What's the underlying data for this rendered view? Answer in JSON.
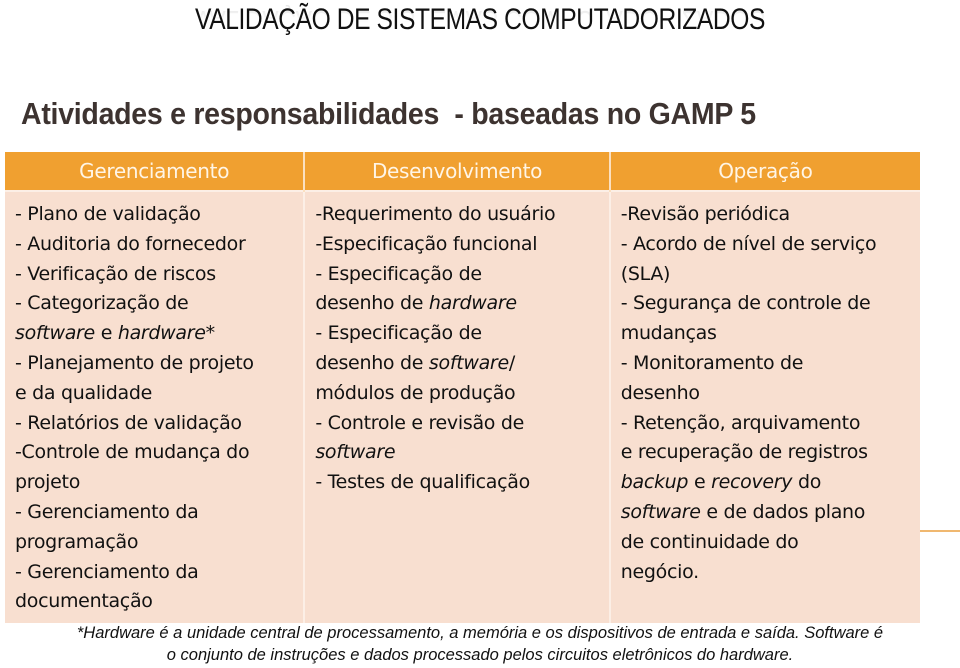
{
  "page": {
    "title": "VALIDAÇÃO DE SISTEMAS COMPUTADORIZADOS",
    "subtitle": "Atividades e responsabilidades  - baseadas no GAMP 5"
  },
  "table": {
    "header_color": "#f0a030",
    "body_color": "#f8dfd0",
    "columns": [
      {
        "header": "Gerenciamento",
        "lines": [
          [
            {
              "t": "- Plano de validação"
            }
          ],
          [
            {
              "t": "- Auditoria do fornecedor"
            }
          ],
          [
            {
              "t": "- Verificação de riscos"
            }
          ],
          [
            {
              "t": "- Categorização de"
            }
          ],
          [
            {
              "t": "software",
              "i": true
            },
            {
              "t": " e "
            },
            {
              "t": "hardware",
              "i": true
            },
            {
              "t": "*"
            }
          ],
          [
            {
              "t": "- Planejamento de projeto"
            }
          ],
          [
            {
              "t": "e da qualidade"
            }
          ],
          [
            {
              "t": "- Relatórios de validação"
            }
          ],
          [
            {
              "t": "-Controle de mudança do"
            }
          ],
          [
            {
              "t": "projeto"
            }
          ],
          [
            {
              "t": "- Gerenciamento da"
            }
          ],
          [
            {
              "t": "programação"
            }
          ],
          [
            {
              "t": "- Gerenciamento da"
            }
          ],
          [
            {
              "t": "documentação"
            }
          ]
        ]
      },
      {
        "header": "Desenvolvimento",
        "lines": [
          [
            {
              "t": "-Requerimento do usuário"
            }
          ],
          [
            {
              "t": "-Especificação funcional"
            }
          ],
          [
            {
              "t": "- Especificação de"
            }
          ],
          [
            {
              "t": "desenho de "
            },
            {
              "t": "hardware",
              "i": true
            }
          ],
          [
            {
              "t": "- Especificação de"
            }
          ],
          [
            {
              "t": "desenho de "
            },
            {
              "t": "software",
              "i": true
            },
            {
              "t": "/"
            }
          ],
          [
            {
              "t": "módulos de produção"
            }
          ],
          [
            {
              "t": "- Controle e revisão de"
            }
          ],
          [
            {
              "t": "software",
              "i": true
            }
          ],
          [
            {
              "t": "- Testes de qualificação"
            }
          ]
        ]
      },
      {
        "header": "Operação",
        "lines": [
          [
            {
              "t": "-Revisão periódica"
            }
          ],
          [
            {
              "t": "- Acordo de nível de serviço"
            }
          ],
          [
            {
              "t": "(SLA)"
            }
          ],
          [
            {
              "t": "- Segurança de controle de"
            }
          ],
          [
            {
              "t": "mudanças"
            }
          ],
          [
            {
              "t": "- Monitoramento de"
            }
          ],
          [
            {
              "t": "desenho"
            }
          ],
          [
            {
              "t": "- Retenção, arquivamento"
            }
          ],
          [
            {
              "t": "e recuperação de registros"
            }
          ],
          [
            {
              "t": "backup",
              "i": true
            },
            {
              "t": " e "
            },
            {
              "t": "recovery",
              "i": true
            },
            {
              "t": " do"
            }
          ],
          [
            {
              "t": "software",
              "i": true
            },
            {
              "t": " e de dados plano"
            }
          ],
          [
            {
              "t": "de continuidade do"
            }
          ],
          [
            {
              "t": "negócio."
            }
          ]
        ]
      }
    ]
  },
  "footnote": {
    "line1": "*Hardware é a unidade central de processamento, a memória e os dispositivos de entrada e saída. Software é",
    "line2": "o conjunto de instruções e dados processado pelos circuitos eletrônicos do hardware."
  }
}
